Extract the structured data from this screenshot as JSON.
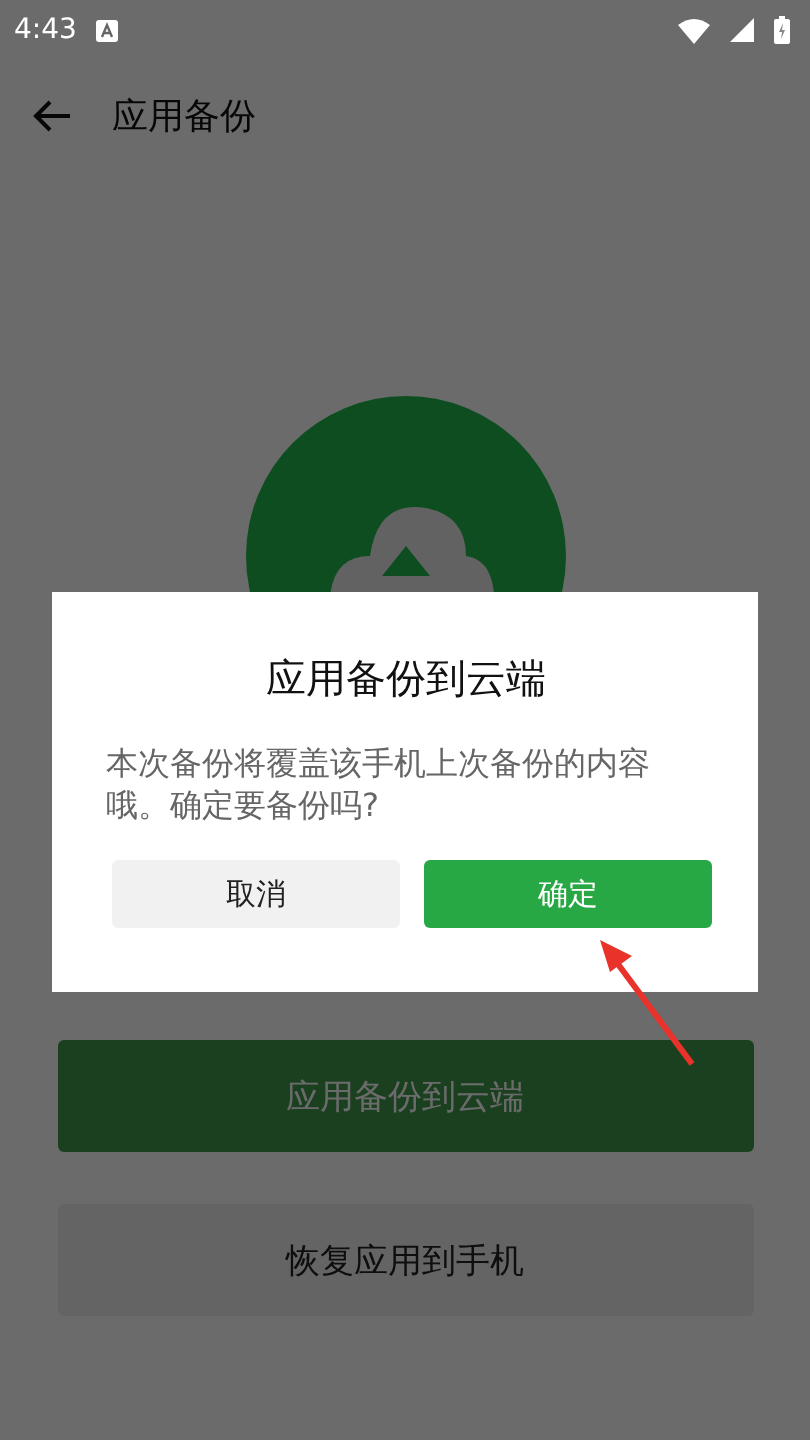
{
  "status_bar": {
    "time": "4:43"
  },
  "app_bar": {
    "title": "应用备份"
  },
  "actions": [
    {
      "label": "应用备份到云端",
      "kind": "primary"
    },
    {
      "label": "恢复应用到手机",
      "kind": "secondary"
    }
  ],
  "dialog": {
    "title": "应用备份到云端",
    "message": "本次备份将覆盖该手机上次备份的内容哦。确定要备份吗?",
    "buttons": [
      {
        "label": "取消",
        "kind": "cancel"
      },
      {
        "label": "确定",
        "kind": "confirm"
      }
    ]
  }
}
